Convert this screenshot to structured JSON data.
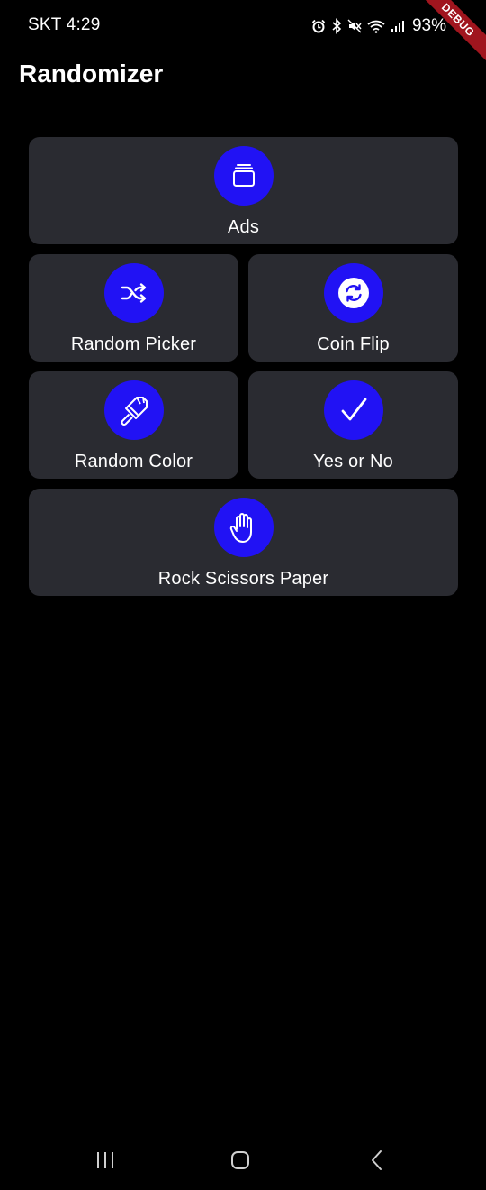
{
  "status_bar": {
    "time": "SKT 4:29",
    "battery": "93%"
  },
  "debug_banner": "DEBUG",
  "app": {
    "title": "Randomizer"
  },
  "menu": {
    "ads": "Ads",
    "random_picker": "Random Picker",
    "coin_flip": "Coin Flip",
    "random_color": "Random Color",
    "yes_or_no": "Yes or No",
    "rock_scissors_paper": "Rock Scissors Paper"
  },
  "colors": {
    "accent": "#2112f4",
    "card_background": "#2a2b31",
    "background": "#000000"
  },
  "icons": {
    "ads": "stacked-cards-icon",
    "random_picker": "shuffle-icon",
    "coin_flip": "coin-flip-icon",
    "random_color": "paint-brush-icon",
    "yes_or_no": "check-icon",
    "rock_scissors_paper": "hand-icon"
  }
}
